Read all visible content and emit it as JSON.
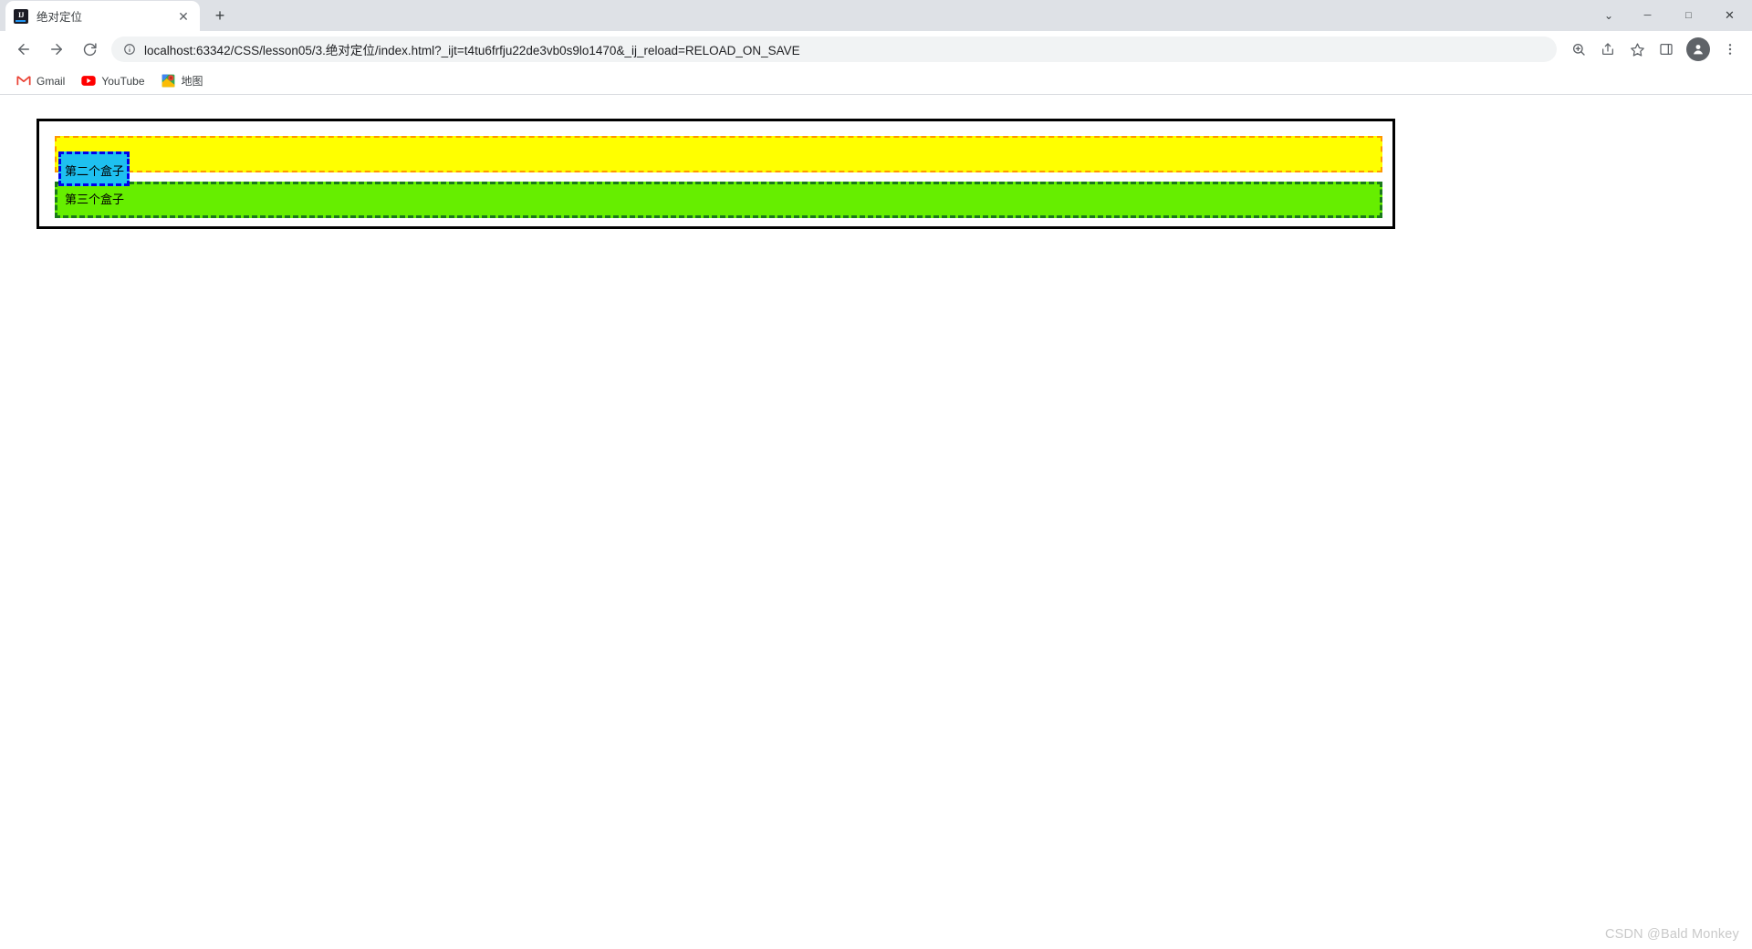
{
  "window": {
    "controls": {
      "chevron_label": "⌄",
      "minimize_label": "─",
      "maximize_label": "□",
      "close_label": "✕"
    }
  },
  "tabstrip": {
    "tabs": [
      {
        "title": "绝对定位",
        "favicon_name": "intellij-idea-favicon",
        "favicon_text": "IJ",
        "close_label": "✕",
        "active": true
      }
    ],
    "new_tab_label": "+"
  },
  "toolbar": {
    "back_label": "←",
    "forward_label": "→",
    "reload_label": "⟳",
    "url": "localhost:63342/CSS/lesson05/3.绝对定位/index.html?_ijt=t4tu6frfju22de3vb0s9lo1470&_ij_reload=RELOAD_ON_SAVE",
    "url_placeholder": "Search Google or type a URL",
    "site_info_label": "ⓘ",
    "icons": [
      {
        "name": "zoom-icon",
        "label": "⊕"
      },
      {
        "name": "share-icon",
        "label": "➦"
      },
      {
        "name": "bookmark-star-icon",
        "label": "☆"
      },
      {
        "name": "sidepanel-icon",
        "label": "▧"
      },
      {
        "name": "profile-avatar-icon",
        "label": "●"
      },
      {
        "name": "more-menu-icon",
        "label": "⋮"
      }
    ]
  },
  "bookmarks": [
    {
      "label": "Gmail",
      "icon": "gmail-icon"
    },
    {
      "label": "YouTube",
      "icon": "youtube-icon"
    },
    {
      "label": "地图",
      "icon": "google-maps-icon"
    }
  ],
  "page": {
    "outer_box_label": "",
    "boxes": {
      "first": {
        "label": "",
        "bg": "#ffff00",
        "border": "#ff9800"
      },
      "second": {
        "label": "第二个盒子",
        "bg": "#1ec0f0",
        "border": "#0000ee"
      },
      "third": {
        "label": "第三个盒子",
        "bg": "#66ee00",
        "border": "#1a7a1a"
      }
    },
    "watermark": "CSDN @Bald Monkey"
  }
}
